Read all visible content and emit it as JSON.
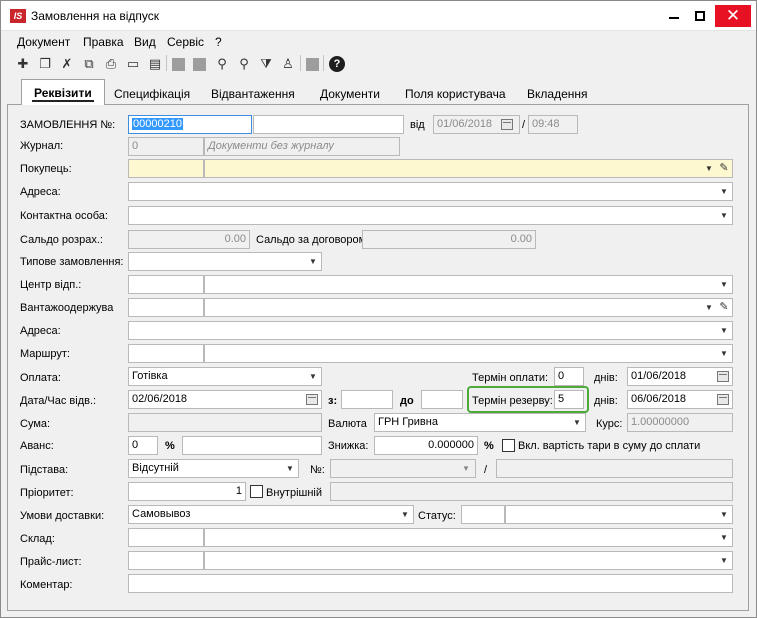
{
  "window": {
    "title": "Замовлення на відпуск",
    "app_icon_text": "IS",
    "close_glyph": "✕"
  },
  "menu": [
    "Документ",
    "Правка",
    "Вид",
    "Сервіс",
    "?"
  ],
  "toolbar": {
    "icons": [
      "add-icon",
      "add-copy-icon",
      "delete-icon",
      "copy-icon",
      "print-icon",
      "open-icon",
      "edit-icon",
      "block-icon",
      "block-icon",
      "search-icon",
      "search-next-icon",
      "filter-icon",
      "structure-icon",
      "block-icon",
      "help-icon"
    ]
  },
  "tabs": [
    "Реквізити",
    "Специфікація",
    "Відвантаження",
    "Документи",
    "Поля користувача",
    "Вкладення"
  ],
  "form": {
    "order_no_label": "ЗАМОВЛЕННЯ №:",
    "order_no": "00000210",
    "from_label": "від",
    "date": "01/06/2018",
    "slash": "/",
    "time": "09:48",
    "journal_label": "Журнал:",
    "journal_code": "0",
    "journal_name": "Документи без журналу",
    "buyer_label": "Покупець:",
    "address_label": "Адреса:",
    "contact_label": "Контактна особа:",
    "balance_label": "Сальдо розрах.:",
    "balance_value": "0.00",
    "contract_balance_label": "Сальдо за договором",
    "contract_balance_value": "0.00",
    "typical_order_label": "Типове замовлення:",
    "center_label": "Центр відп.:",
    "consignee_label": "Вантажоодержува",
    "address2_label": "Адреса:",
    "route_label": "Маршрут:",
    "payment_label": "Оплата:",
    "payment_value": "Готівка",
    "payment_term_label": "Термін оплати:",
    "payment_term_value": "0",
    "days_label": "днів:",
    "payment_date": "01/06/2018",
    "ship_date_label": "Дата/Час відв.:",
    "ship_date": "02/06/2018",
    "from_time_label": "з:",
    "to_time_label": "до",
    "reserve_term_label": "Термін резерву:",
    "reserve_term_value": "5",
    "days2_label": "днів:",
    "reserve_date": "06/06/2018",
    "sum_label": "Сума:",
    "currency_label": "Валюта",
    "currency_value": "ГРН Гривна",
    "rate_label": "Курс:",
    "rate_value": "1.00000000",
    "advance_label": "Аванс:",
    "advance_value": "0",
    "percent": "%",
    "discount_label": "Знижка:",
    "discount_value": "0.000000",
    "percent2": "%",
    "tare_label": "Вкл. вартість тари в суму до сплати",
    "basis_label": "Підстава:",
    "basis_value": "Відсутній",
    "no_label": "№:",
    "slash2": "/",
    "priority_label": "Пріоритет:",
    "priority_value": "1",
    "internal_label": "Внутрішній",
    "delivery_label": "Умови доставки:",
    "delivery_value": "Самовывоз",
    "status_label": "Статус:",
    "warehouse_label": "Склад:",
    "pricelist_label": "Прайс-лист:",
    "comment_label": "Коментар:"
  },
  "colors": {
    "highlight": "#4caa3a",
    "selection": "#3399ff",
    "required": "#fdf8d0",
    "close": "#e81123",
    "logo": "#c8262b"
  }
}
